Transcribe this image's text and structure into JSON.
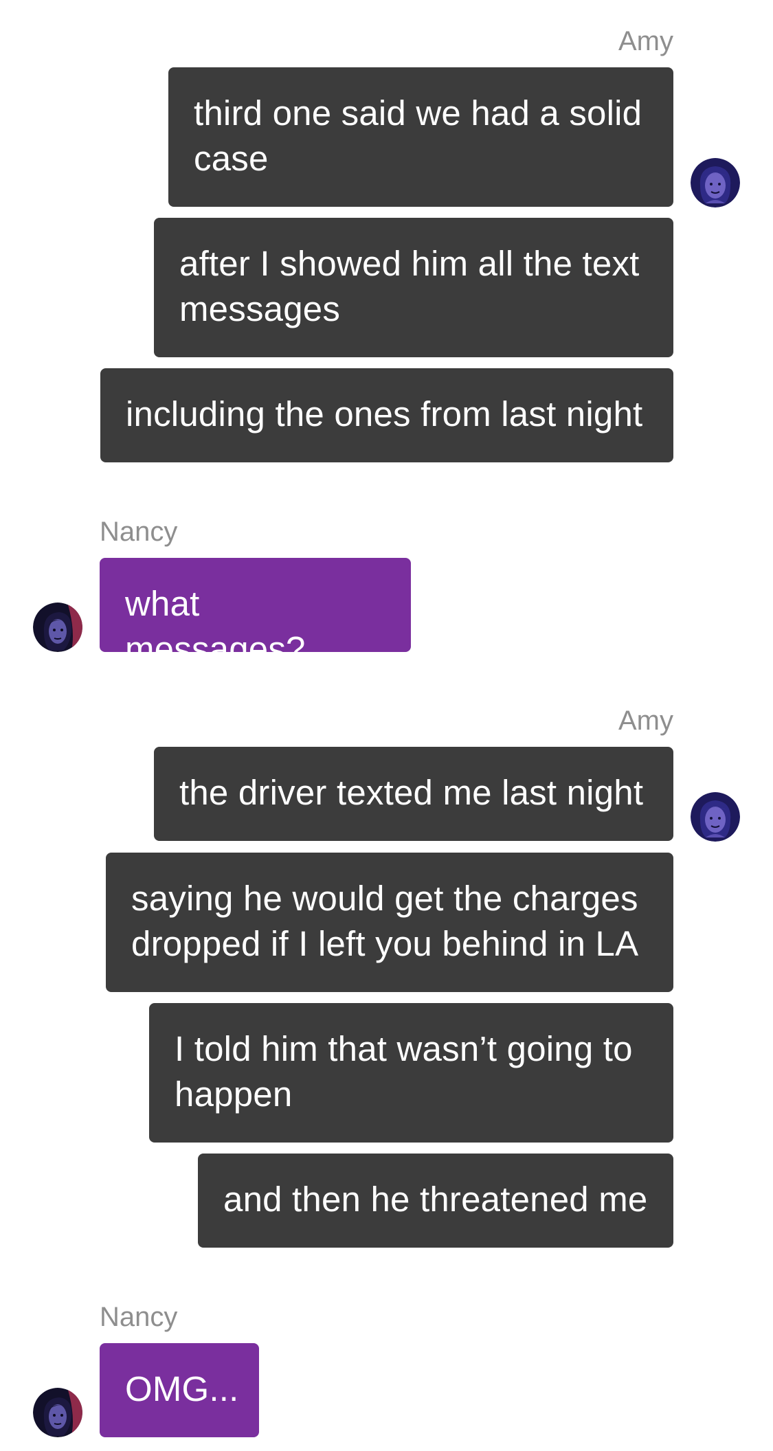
{
  "conversation": {
    "participants": {
      "amy": {
        "name": "Amy",
        "bubble_color": "#3c3c3c",
        "avatar_icon": "amy-avatar"
      },
      "nancy": {
        "name": "Nancy",
        "bubble_color": "#7a2f9e",
        "avatar_icon": "nancy-avatar"
      }
    },
    "groups": [
      {
        "sender": "Amy",
        "messages": [
          "third one said we had a solid case",
          "after I showed him all the text messages",
          "including the ones from last night"
        ]
      },
      {
        "sender": "Nancy",
        "messages": [
          "what messages?"
        ]
      },
      {
        "sender": "Amy",
        "messages": [
          "the driver texted me last night",
          "saying he would get the charges dropped if I left you behind in LA",
          "I told him that wasn’t going to happen",
          "and then he threatened me"
        ]
      },
      {
        "sender": "Nancy",
        "messages": [
          "OMG..."
        ]
      }
    ]
  }
}
